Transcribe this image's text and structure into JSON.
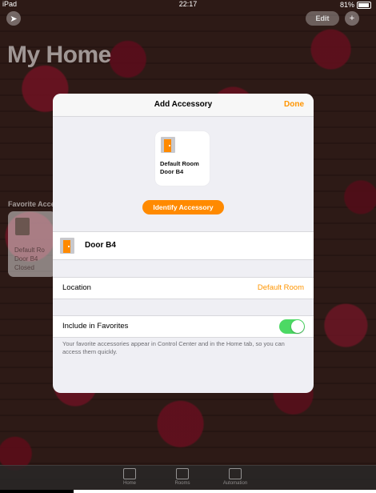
{
  "status_bar": {
    "carrier": "iPad",
    "time": "22:17",
    "battery": "81%"
  },
  "home": {
    "title": "My Home",
    "edit_label": "Edit",
    "add_label": "+",
    "favorites_label": "Favorite Acce",
    "tile_lines": [
      "Default Ro",
      "Door B4",
      "Closed"
    ]
  },
  "modal": {
    "title": "Add Accessory",
    "done_label": "Done",
    "accessory_tile_lines": [
      "Default Room",
      "Door B4"
    ],
    "identify_label": "Identify Accessory",
    "name_value": "Door B4",
    "location_label": "Location",
    "location_value": "Default Room",
    "favorites_label": "Include in Favorites",
    "favorites_enabled": true,
    "footnote": "Your favorite accessories appear in Control Center and in the Home tab, so you can access them quickly."
  },
  "tabbar": {
    "tabs": [
      {
        "label": "Home"
      },
      {
        "label": "Rooms"
      },
      {
        "label": "Automation"
      }
    ]
  },
  "colors": {
    "accent": "#ff9500",
    "toggle_on": "#4cd964"
  }
}
